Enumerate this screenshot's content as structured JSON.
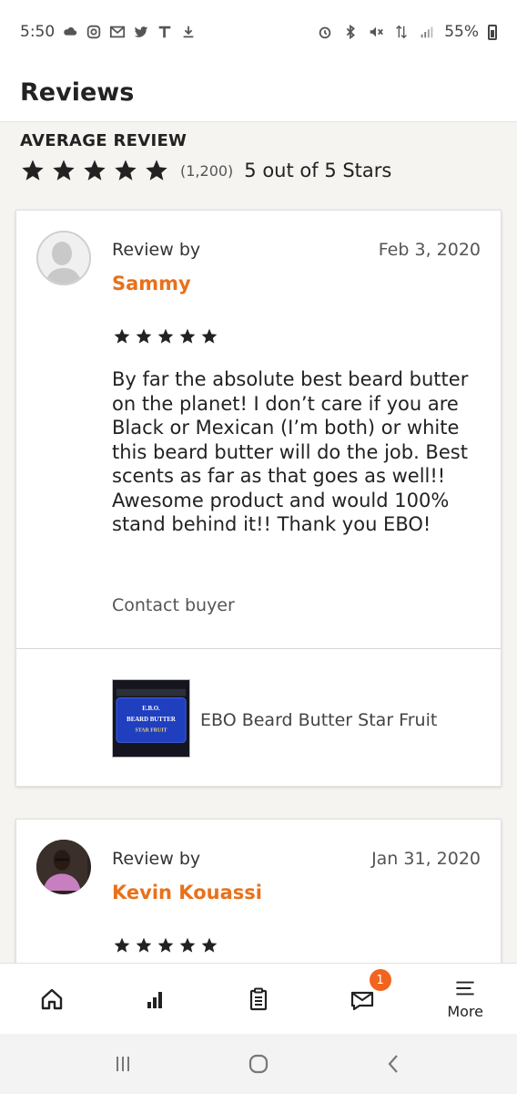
{
  "status_bar": {
    "time": "5:50",
    "battery": "55%",
    "icons": [
      "cloud-icon",
      "instagram-icon",
      "gmail-icon",
      "twitter-icon",
      "tmobile-icon",
      "download-icon",
      "alarm-icon",
      "bluetooth-icon",
      "mute-icon",
      "data-icon",
      "signal-icon",
      "battery-icon"
    ]
  },
  "header": {
    "title": "Reviews"
  },
  "average": {
    "label": "AVERAGE REVIEW",
    "count": "(1,200)",
    "text": "5 out of 5 Stars",
    "stars": 5
  },
  "reviews": [
    {
      "by_label": "Review by",
      "reviewer": "Sammy",
      "date": "Feb 3, 2020",
      "stars": 5,
      "text": "By far the absolute best beard butter on the planet! I don’t care if you are Black or Mexican (I’m both) or white this beard butter will do the job. Best scents as far as that goes as well!! Awesome product and would 100% stand behind it!! Thank you EBO!",
      "contact_label": "Contact buyer",
      "product_name": "EBO Beard Butter Star Fruit",
      "product_label_lines": [
        "E.B.O.",
        "BEARD BUTTER",
        "STAR FRUIT"
      ]
    },
    {
      "by_label": "Review by",
      "reviewer": "Kevin Kouassi",
      "date": "Jan 31, 2020",
      "stars": 5
    }
  ],
  "bottom_nav": {
    "items": [
      {
        "name": "home-icon"
      },
      {
        "name": "stats-icon"
      },
      {
        "name": "orders-icon"
      },
      {
        "name": "messages-icon",
        "badge": "1"
      },
      {
        "name": "menu-icon",
        "label": "More"
      }
    ]
  },
  "colors": {
    "accent": "#e8711b",
    "badge": "#f1641e",
    "background": "#f5f4f1"
  }
}
